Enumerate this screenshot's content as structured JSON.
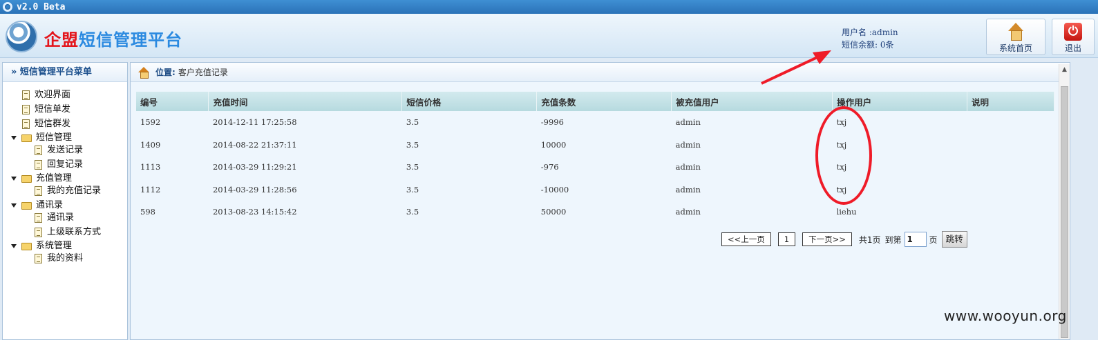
{
  "window": {
    "title": "v2.0 Beta"
  },
  "header": {
    "brand_part1": "企盟",
    "brand_part2": "短信管理平台",
    "user_label": "用户名 :admin",
    "balance_label": "短信余额: 0条",
    "home_button": "系统首页",
    "exit_button": "退出"
  },
  "sidebar": {
    "title": "» 短信管理平台菜单",
    "items": [
      {
        "label": "欢迎界面",
        "type": "doc"
      },
      {
        "label": "短信单发",
        "type": "doc"
      },
      {
        "label": "短信群发",
        "type": "doc"
      },
      {
        "label": "短信管理",
        "type": "folder"
      },
      {
        "label": "发送记录",
        "type": "doc"
      },
      {
        "label": "回复记录",
        "type": "doc"
      },
      {
        "label": "充值管理",
        "type": "folder"
      },
      {
        "label": "我的充值记录",
        "type": "doc"
      },
      {
        "label": "通讯录",
        "type": "folder"
      },
      {
        "label": "通讯录",
        "type": "doc"
      },
      {
        "label": "上级联系方式",
        "type": "doc"
      },
      {
        "label": "系统管理",
        "type": "folder"
      },
      {
        "label": "我的资料",
        "type": "doc"
      }
    ]
  },
  "breadcrumb": {
    "prefix": "位置:",
    "current": "客户充值记录"
  },
  "table": {
    "headers": [
      "编号",
      "充值时间",
      "短信价格",
      "充值条数",
      "被充值用户",
      "操作用户",
      "说明"
    ],
    "rows": [
      [
        "1592",
        "2014-12-11 17:25:58",
        "3.5",
        "-9996",
        "admin",
        "txj",
        ""
      ],
      [
        "1409",
        "2014-08-22 21:37:11",
        "3.5",
        "10000",
        "admin",
        "txj",
        ""
      ],
      [
        "1113",
        "2014-03-29 11:29:21",
        "3.5",
        "-976",
        "admin",
        "txj",
        ""
      ],
      [
        "1112",
        "2014-03-29 11:28:56",
        "3.5",
        "-10000",
        "admin",
        "txj",
        ""
      ],
      [
        "598",
        "2013-08-23 14:15:42",
        "3.5",
        "50000",
        "admin",
        "liehu",
        ""
      ]
    ]
  },
  "pager": {
    "prev": "<<上一页",
    "page": "1",
    "next": "下一页>>",
    "total": "共1页",
    "goto_label": "到第",
    "goto_value": "1",
    "page_unit": "页",
    "jump": "跳转"
  },
  "watermark": "www.wooyun.org",
  "colors": {
    "annotation": "#ef1b28",
    "brand_red": "#e4151b",
    "brand_blue": "#2b8ae0"
  }
}
